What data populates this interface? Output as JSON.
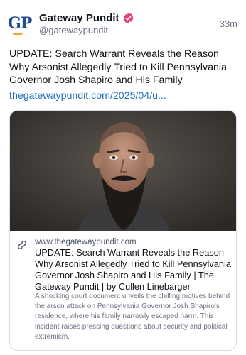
{
  "author": {
    "avatar_text": "GP",
    "display_name": "Gateway Pundit",
    "handle": "@gatewaypundit",
    "verified_color": "#e0457b"
  },
  "timestamp": "33m",
  "post": {
    "text": "UPDATE: Search Warrant Reveals the Reason Why Arsonist Allegedly Tried to Kill Pennsylvania Governor Josh Shapiro and His Family",
    "link": "thegatewaypundit.com/2025/04/u..."
  },
  "card": {
    "image_icon": "portrait-photo",
    "domain": "www.thegatewaypundit.com",
    "title": "UPDATE: Search Warrant Reveals the Reason Why Arsonist Allegedly Tried to Kill Pennsylvania Governor Josh Shapiro and His Family | The Gateway Pundit | by Cullen Linebarger",
    "description": "A shocking court document unveils the chilling motives behind the arson attack on Pennsylvania Governor Josh Shapiro's residence, where his family narrowly escaped harm. This incident raises pressing questions about security and political extremism."
  },
  "colors": {
    "link": "#1d6fb8",
    "secondary_text": "#6b7280",
    "border": "#d8dde3"
  }
}
